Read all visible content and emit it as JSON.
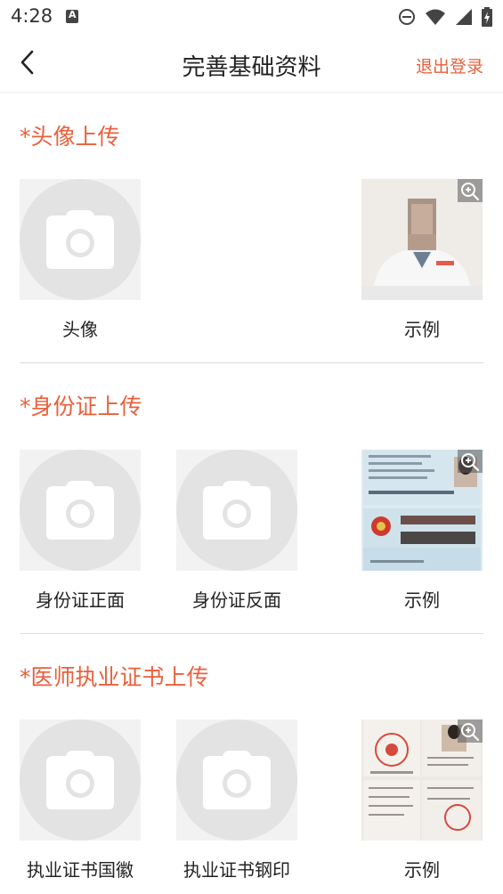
{
  "status_bar": {
    "time": "4:28"
  },
  "nav": {
    "title": "完善基础资料",
    "logout": "退出登录"
  },
  "sections": [
    {
      "title": "*头像上传",
      "items": [
        {
          "label": "头像"
        }
      ],
      "example_label": "示例"
    },
    {
      "title": "*身份证上传",
      "items": [
        {
          "label": "身份证正面"
        },
        {
          "label": "身份证反面"
        }
      ],
      "example_label": "示例"
    },
    {
      "title": "*医师执业证书上传",
      "items": [
        {
          "label": "执业证书国徽"
        },
        {
          "label": "执业证书钢印"
        }
      ],
      "example_label": "示例"
    }
  ],
  "colors": {
    "accent": "#e8603c",
    "placeholder_bg": "#f2f2f2",
    "placeholder_circle": "#e3e3e3"
  }
}
